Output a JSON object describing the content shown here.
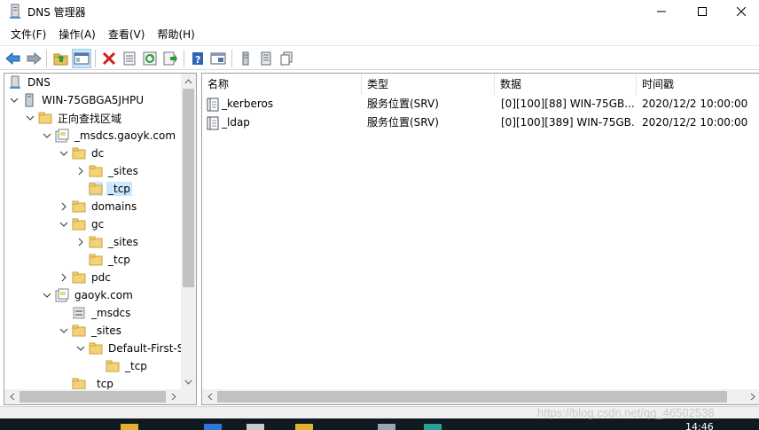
{
  "window": {
    "title": "DNS 管理器"
  },
  "menu": [
    "文件(F)",
    "操作(A)",
    "查看(V)",
    "帮助(H)"
  ],
  "toolbar": {
    "buttons": [
      "back-icon",
      "forward-icon",
      "up-folder-icon",
      "show-hide-tree-icon",
      "delete-icon",
      "properties-icon",
      "refresh-icon",
      "export-list-icon",
      "help-icon",
      "console-view-icon",
      "server-icon",
      "list-icon",
      "copy-icon"
    ]
  },
  "tree": [
    {
      "label": "DNS"
    },
    {
      "label": "WIN-75GBGA5JHPU"
    },
    {
      "label": "正向查找区域"
    },
    {
      "label": "_msdcs.gaoyk.com"
    },
    {
      "label": "dc"
    },
    {
      "label": "_sites"
    },
    {
      "label": "_tcp"
    },
    {
      "label": "domains"
    },
    {
      "label": "gc"
    },
    {
      "label": "_sites"
    },
    {
      "label": "_tcp"
    },
    {
      "label": "pdc"
    },
    {
      "label": "gaoyk.com"
    },
    {
      "label": "_msdcs"
    },
    {
      "label": "_sites"
    },
    {
      "label": "Default-First-S"
    },
    {
      "label": "_tcp"
    },
    {
      "label": "_tcp"
    }
  ],
  "list": {
    "columns": [
      "名称",
      "类型",
      "数据",
      "时间戳"
    ],
    "rows": [
      {
        "name": "_kerberos",
        "type": "服务位置(SRV)",
        "data": "[0][100][88] WIN-75GB...",
        "timestamp": "2020/12/2 10:00:00"
      },
      {
        "name": "_ldap",
        "type": "服务位置(SRV)",
        "data": "[0][100][389] WIN-75GB...",
        "timestamp": "2020/12/2 10:00:00"
      }
    ]
  },
  "taskbar": {
    "clock": "14:46"
  },
  "watermark": "https://blog.csdn.net/qq_46502538"
}
